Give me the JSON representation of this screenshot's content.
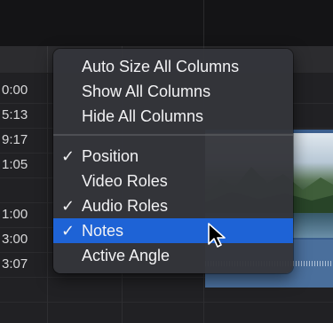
{
  "timecodes": [
    "0:00",
    "5:13",
    "9:17",
    "1:05",
    "1:00",
    "3:00",
    "3:07"
  ],
  "menu": {
    "group1": [
      {
        "label": "Auto Size All Columns",
        "checked": false
      },
      {
        "label": "Show All Columns",
        "checked": false
      },
      {
        "label": "Hide All Columns",
        "checked": false
      }
    ],
    "group2": [
      {
        "label": "Position",
        "checked": true
      },
      {
        "label": "Video Roles",
        "checked": false
      },
      {
        "label": "Audio Roles",
        "checked": true
      },
      {
        "label": "Notes",
        "checked": true,
        "selected": true
      },
      {
        "label": "Active Angle",
        "checked": false
      }
    ],
    "check_glyph": "✓"
  },
  "colors": {
    "selection": "#1e63d6",
    "menu_bg": "#34353a",
    "background": "#212124"
  },
  "icons": {
    "cursor": "arrow-pointer-icon",
    "check": "checkmark-icon"
  }
}
